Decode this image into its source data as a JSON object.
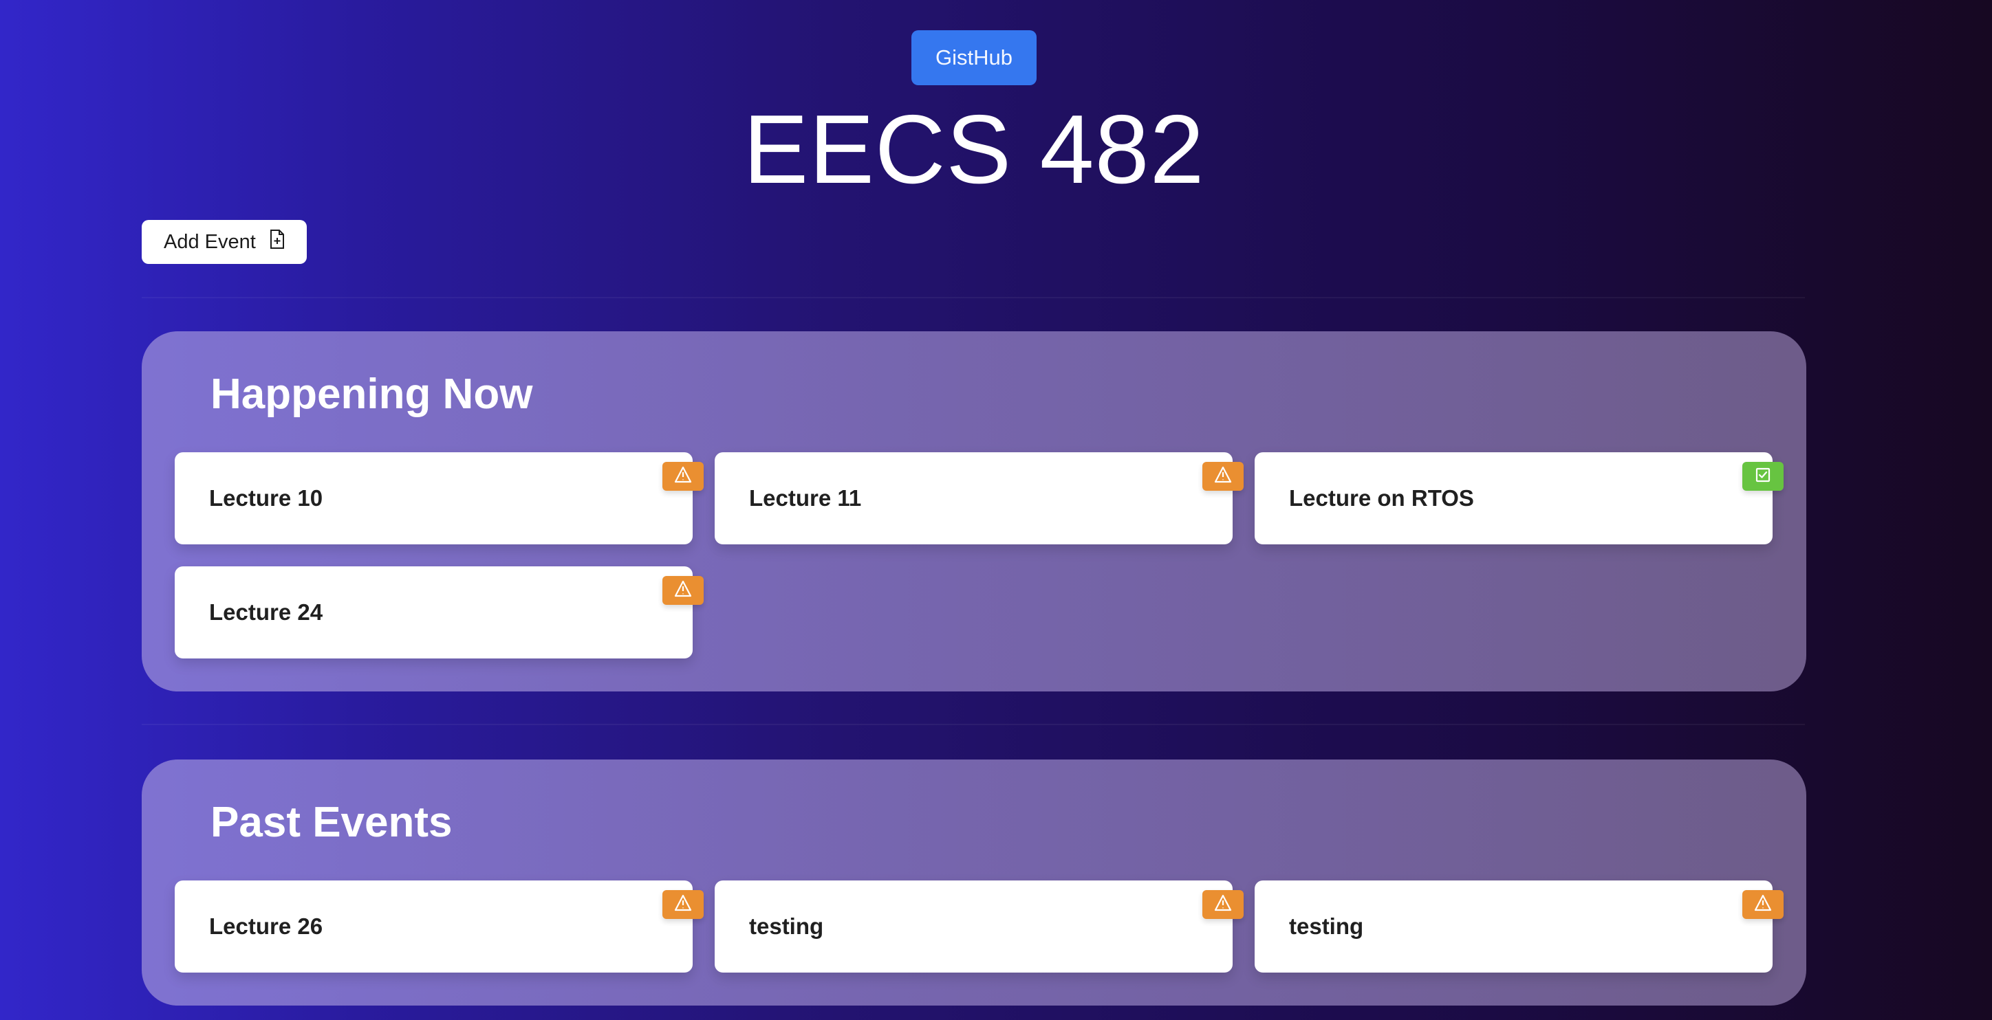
{
  "header": {
    "brand_button": "GistHub",
    "page_title": "EECS 482",
    "add_event_label": "Add Event"
  },
  "sections": [
    {
      "title": "Happening Now",
      "events": [
        {
          "label": "Lecture 10",
          "status": "warning",
          "icon": "warning-icon"
        },
        {
          "label": "Lecture 11",
          "status": "warning",
          "icon": "warning-icon"
        },
        {
          "label": "Lecture on RTOS",
          "status": "complete",
          "icon": "checkbox-check-icon"
        },
        {
          "label": "Lecture 24",
          "status": "warning",
          "icon": "warning-icon"
        }
      ]
    },
    {
      "title": "Past Events",
      "events": [
        {
          "label": "Lecture 26",
          "status": "warning",
          "icon": "warning-icon"
        },
        {
          "label": "testing",
          "status": "warning",
          "icon": "warning-icon"
        },
        {
          "label": "testing",
          "status": "warning",
          "icon": "warning-icon"
        }
      ]
    }
  ],
  "colors": {
    "brand": "#3577ef",
    "warning": "#ea8f31",
    "success": "#67c441",
    "card_text": "#202020"
  }
}
